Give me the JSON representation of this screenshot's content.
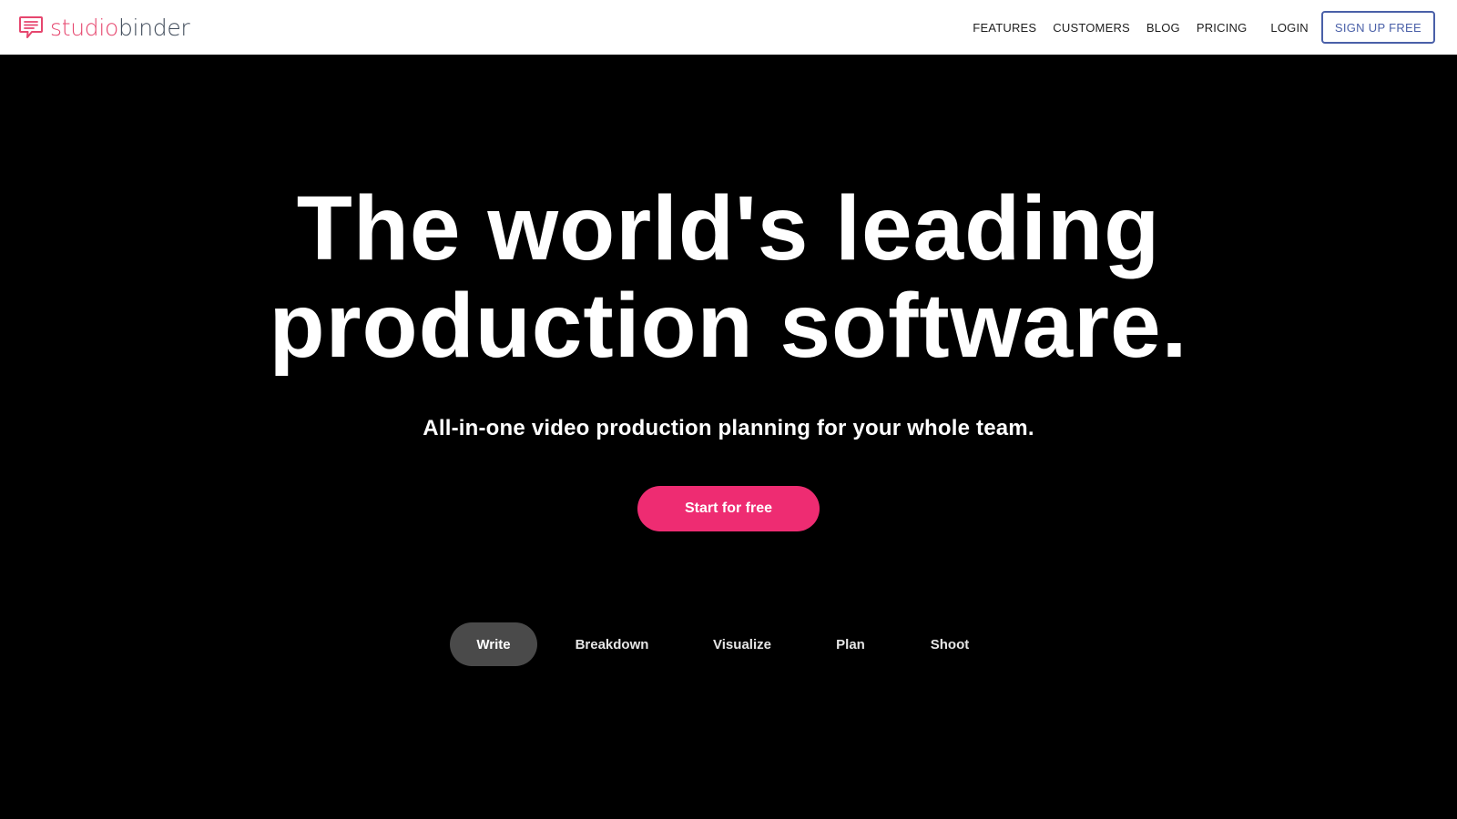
{
  "header": {
    "logo": {
      "icon": "speech-bubble-icon",
      "text_studio": "studio",
      "text_binder": "binder"
    },
    "nav": [
      {
        "label": "FEATURES"
      },
      {
        "label": "CUSTOMERS"
      },
      {
        "label": "BLOG"
      },
      {
        "label": "PRICING"
      }
    ],
    "login_label": "LOGIN",
    "signup_label": "SIGN UP FREE"
  },
  "hero": {
    "title_line1": "The world's leading",
    "title_line2": "production software.",
    "subtitle": "All-in-one video production planning for your whole team.",
    "cta_label": "Start for free"
  },
  "tabs": {
    "items": [
      {
        "label": "Write",
        "active": true
      },
      {
        "label": "Breakdown",
        "active": false
      },
      {
        "label": "Visualize",
        "active": false
      },
      {
        "label": "Plan",
        "active": false
      },
      {
        "label": "Shoot",
        "active": false
      }
    ]
  },
  "colors": {
    "brand_pink": "#e6466e",
    "brand_dark": "#3f4a59",
    "cta_pink": "#ee2c72",
    "signup_blue": "#4a60a8",
    "hero_background": "#000000",
    "active_tab": "#4a4a4a"
  }
}
